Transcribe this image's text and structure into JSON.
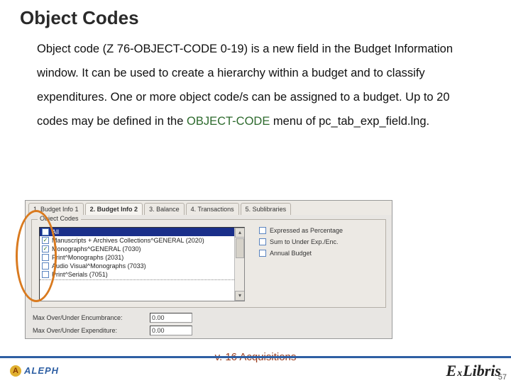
{
  "title": "Object Codes",
  "body": {
    "p1a": "Object code (",
    "p1code": "Z 76-OBJECT-CODE 0-19",
    "p1b": ") is a new field in the Budget Information window. It can be used to create a hierarchy within a budget and to classify expenditures. One or more object code/s can be assigned to a budget. Up to 20 codes may be defined in the ",
    "p1hl": "OBJECT-CODE",
    "p1c": " menu of  pc_tab_exp_field.lng."
  },
  "tabs": [
    "1. Budget Info 1",
    "2. Budget Info 2",
    "3. Balance",
    "4. Transactions",
    "5. Sublibraries"
  ],
  "group_label": "Object Codes",
  "options": [
    {
      "checked": false,
      "selected": true,
      "label": "All"
    },
    {
      "checked": true,
      "selected": false,
      "label": "Manuscripts + Archives Collections^GENERAL (2020)"
    },
    {
      "checked": true,
      "selected": false,
      "label": "Monographs^GENERAL (7030)"
    },
    {
      "checked": false,
      "selected": false,
      "label": "Print^Monographs (2031)"
    },
    {
      "checked": false,
      "selected": false,
      "label": "Audio Visual^Monographs (7033)"
    },
    {
      "checked": false,
      "selected": false,
      "label": "Print^Serials (7051)"
    }
  ],
  "right_checks": [
    "Expressed as Percentage",
    "Sum to Under Exp./Enc.",
    "Annual Budget"
  ],
  "rows": [
    {
      "label": "Max Over/Under Encumbrance:",
      "value": "0.00"
    },
    {
      "label": "Max Over/Under Expenditure:",
      "value": "0.00"
    }
  ],
  "footer": {
    "left": "ALEPH",
    "center": "v. 16 Acquisitions",
    "right_e": "E",
    "right_x": "x",
    "right_rest": "Libris",
    "page": "57"
  }
}
